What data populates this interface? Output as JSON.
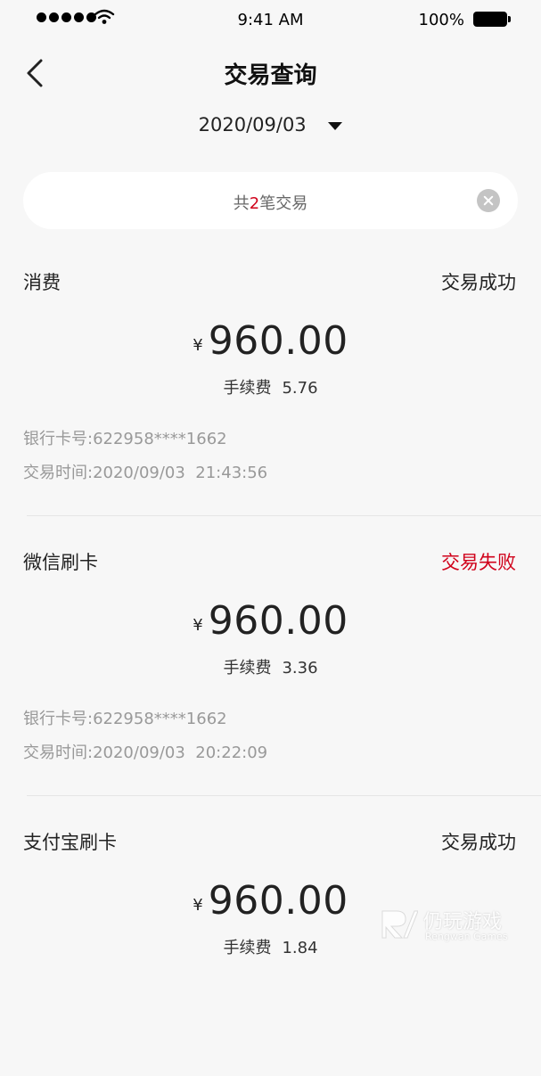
{
  "status_bar": {
    "time": "9:41 AM",
    "battery": "100%"
  },
  "nav": {
    "title": "交易查询",
    "back_icon": "chevron-left-icon"
  },
  "date_filter": {
    "value": "2020/09/03"
  },
  "summary": {
    "prefix": "共",
    "count": "2",
    "suffix": "笔交易"
  },
  "transactions": [
    {
      "type": "消费",
      "status": "交易成功",
      "status_kind": "success",
      "currency": "¥",
      "amount": "960.00",
      "fee_label": "手续费",
      "fee": "5.76",
      "card_label": "银行卡号:",
      "card": "622958****1662",
      "time_label": "交易时间:",
      "time": "2020/09/03  21:43:56"
    },
    {
      "type": "微信刷卡",
      "status": "交易失败",
      "status_kind": "fail",
      "currency": "¥",
      "amount": "960.00",
      "fee_label": "手续费",
      "fee": "3.36",
      "card_label": "银行卡号:",
      "card": "622958****1662",
      "time_label": "交易时间:",
      "time": "2020/09/03  20:22:09"
    },
    {
      "type": "支付宝刷卡",
      "status": "交易成功",
      "status_kind": "success",
      "currency": "¥",
      "amount": "960.00",
      "fee_label": "手续费",
      "fee": "1.84"
    }
  ],
  "watermark": {
    "cn": "仍玩游戏",
    "en": "Rengwan Games"
  },
  "colors": {
    "background": "#f7f7f7",
    "accent_red": "#d0021b",
    "muted_text": "#999999"
  }
}
